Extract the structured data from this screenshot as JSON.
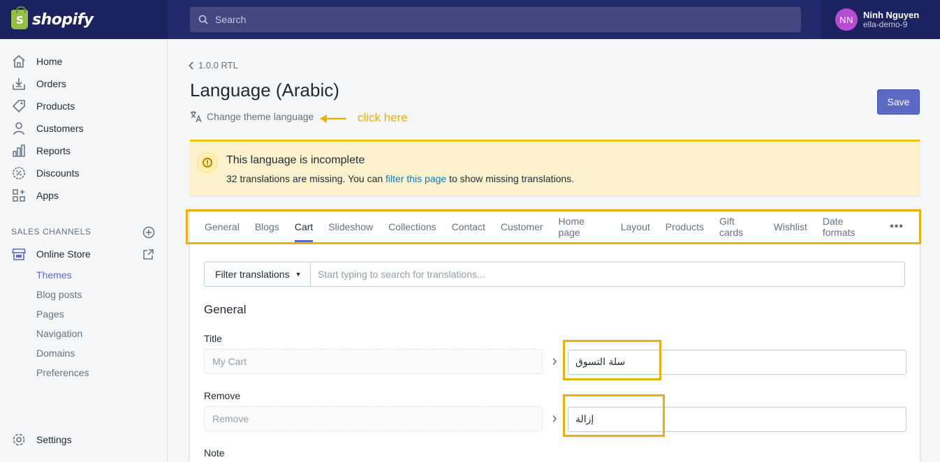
{
  "brand": {
    "name": "shopify",
    "logo_letter": "S"
  },
  "search": {
    "placeholder": "Search"
  },
  "user": {
    "initials": "NN",
    "name": "Ninh Nguyen",
    "store": "ella-demo-9"
  },
  "sidebar": {
    "items": [
      {
        "label": "Home",
        "icon": "home-icon"
      },
      {
        "label": "Orders",
        "icon": "orders-icon"
      },
      {
        "label": "Products",
        "icon": "tag-icon"
      },
      {
        "label": "Customers",
        "icon": "person-icon"
      },
      {
        "label": "Reports",
        "icon": "chart-icon"
      },
      {
        "label": "Discounts",
        "icon": "discount-icon"
      },
      {
        "label": "Apps",
        "icon": "apps-icon"
      }
    ],
    "sales_channels_title": "SALES CHANNELS",
    "online_store": "Online Store",
    "sub_items": [
      "Themes",
      "Blog posts",
      "Pages",
      "Navigation",
      "Domains",
      "Preferences"
    ],
    "active_sub_item": "Themes",
    "settings": "Settings"
  },
  "page": {
    "breadcrumb": "1.0.0 RTL",
    "title": "Language (Arabic)",
    "change_language": "Change theme language",
    "save_label": "Save"
  },
  "annotation": {
    "text": "click here",
    "color": "#e8b10c"
  },
  "banner": {
    "title": "This language is incomplete",
    "body_before": "32 translations are missing. You can ",
    "link": "filter this page",
    "body_after": " to show missing translations."
  },
  "tabs": [
    "General",
    "Blogs",
    "Cart",
    "Slideshow",
    "Collections",
    "Contact",
    "Customer",
    "Home page",
    "Layout",
    "Products",
    "Gift cards",
    "Wishlist",
    "Date formats"
  ],
  "active_tab": "Cart",
  "more_label": "•••",
  "filter": {
    "button_label": "Filter translations",
    "placeholder": "Start typing to search for translations..."
  },
  "section": {
    "title": "General",
    "fields": [
      {
        "label": "Title",
        "source": "My Cart",
        "translation": "سلة التسوق"
      },
      {
        "label": "Remove",
        "source": "Remove",
        "translation": "إزالة"
      },
      {
        "label": "Note"
      }
    ]
  },
  "colors": {
    "accent": "#5c6ac4",
    "topbar": "#1c2260",
    "warning_bg": "#fcf1cd",
    "highlight": "#e8b10c"
  }
}
